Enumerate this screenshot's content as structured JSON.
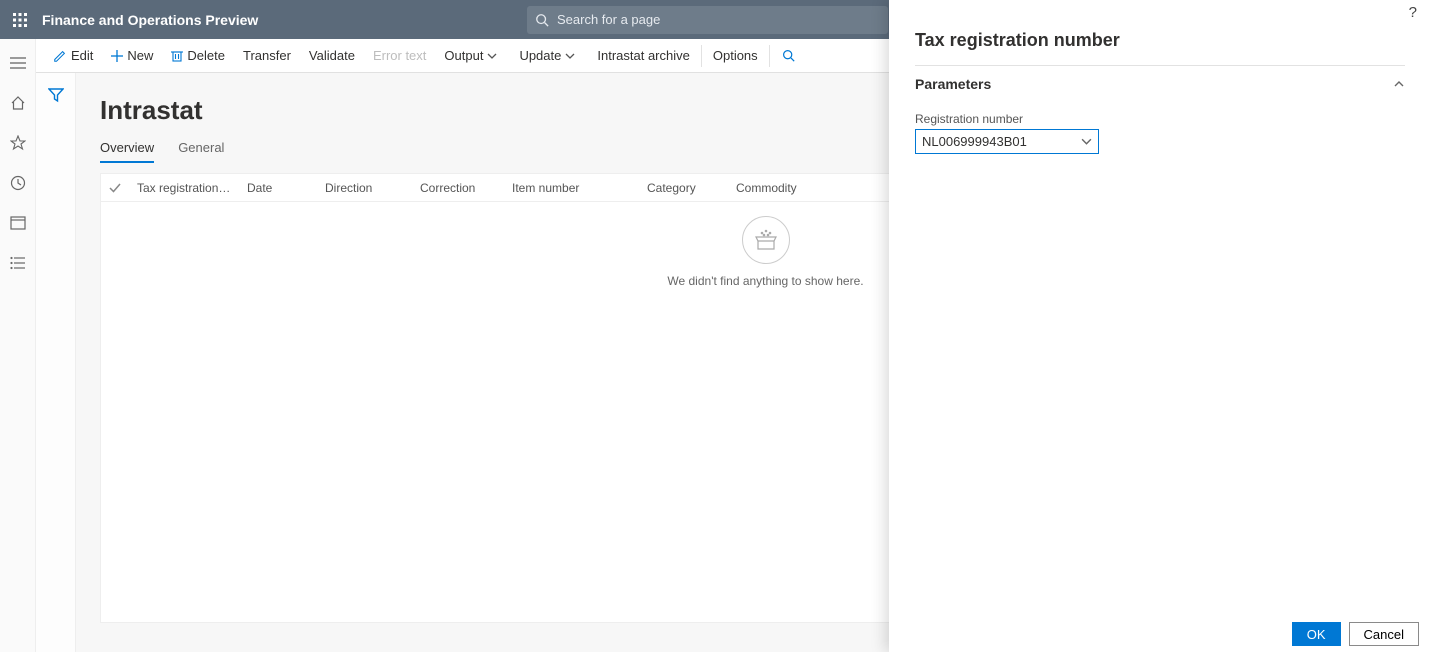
{
  "topbar": {
    "title": "Finance and Operations Preview",
    "search_placeholder": "Search for a page"
  },
  "actions": {
    "edit": "Edit",
    "new": "New",
    "delete": "Delete",
    "transfer": "Transfer",
    "validate": "Validate",
    "error_text": "Error text",
    "output": "Output",
    "update": "Update",
    "intrastat_archive": "Intrastat archive",
    "options": "Options"
  },
  "page": {
    "title": "Intrastat",
    "tabs": {
      "overview": "Overview",
      "general": "General"
    }
  },
  "grid": {
    "cols": {
      "reg": "Tax registration num...",
      "date": "Date",
      "direction": "Direction",
      "correction": "Correction",
      "item": "Item number",
      "category": "Category",
      "commodity": "Commodity"
    },
    "empty": "We didn't find anything to show here."
  },
  "flyout": {
    "title": "Tax registration number",
    "section": "Parameters",
    "field_label": "Registration number",
    "field_value": "NL006999943B01",
    "ok": "OK",
    "cancel": "Cancel"
  }
}
